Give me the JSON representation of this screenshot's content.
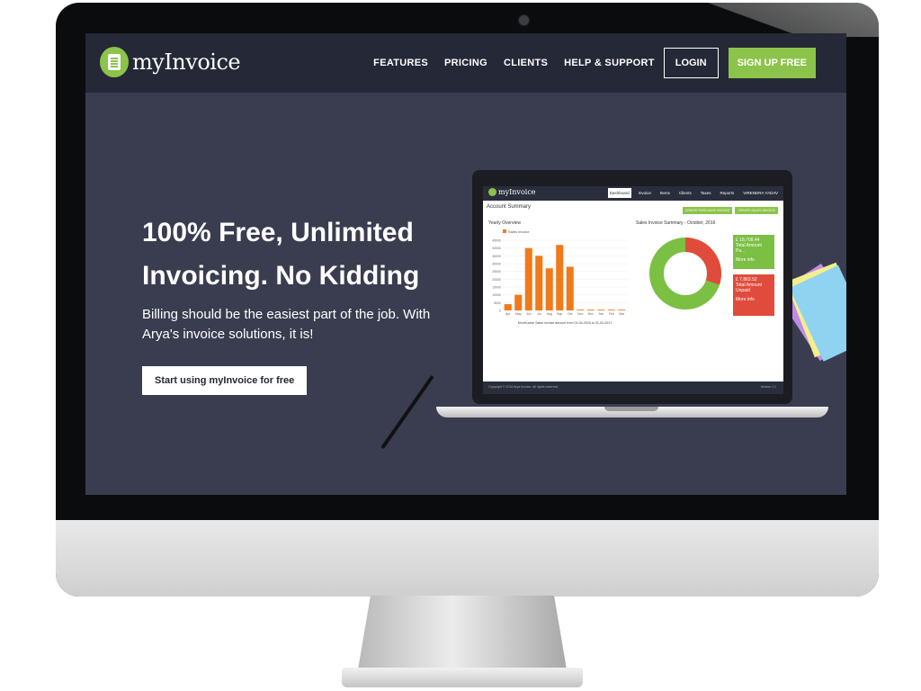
{
  "brand": {
    "name": "myInvoice",
    "accent": "#8cc34a"
  },
  "nav": {
    "links": [
      "FEATURES",
      "PRICING",
      "CLIENTS",
      "HELP & SUPPORT"
    ],
    "login": "LOGIN",
    "signup": "SIGN UP FREE"
  },
  "hero": {
    "title": "100% Free, Unlimited Invoicing. No Kidding",
    "subtitle": "Billing should be the easiest part of the job. With Arya's invoice solutions, it is!",
    "cta": "Start using myInvoice for free"
  },
  "preview": {
    "app_name": "myInvoice",
    "tabs": [
      "Dashboard",
      "Invoice",
      "Items",
      "Clients",
      "Taxes",
      "Reports"
    ],
    "active_tab": "Dashboard",
    "user": "VIRENDRA YADAV",
    "page_heading": "Account Summary",
    "actions": [
      "CREATE PURCHASE INVOICE",
      "CREATE SALES INVOICE"
    ],
    "yearly_heading": "Yearly Overview",
    "sales_summary_heading": "Sales Invoice Summary - October, 2016",
    "legend": "Sales invoice",
    "chart_caption": "Month-wise Sales invoice amount from 01-04-2016 to 31-03-2017",
    "stat_total": {
      "value": "£ 18,708.44",
      "label": "Total Amount Pa...",
      "link": "More info"
    },
    "stat_unpaid": {
      "value": "£ 7,863.52",
      "label": "Total Amount Unpaid",
      "link": "More info"
    },
    "footer": "Copyright © 2016 Arya Invoice. All rights reserved.",
    "version": "Version 1.1"
  },
  "chart_data": {
    "type": "bar",
    "categories": [
      "Apr",
      "May",
      "Jun",
      "Jul",
      "Aug",
      "Sep",
      "Oct",
      "Nov",
      "Dec",
      "Jan",
      "Feb",
      "Mar"
    ],
    "values": [
      4000,
      10000,
      40000,
      35000,
      27000,
      42000,
      28000,
      500,
      500,
      500,
      500,
      500
    ],
    "ylim": [
      0,
      45000
    ],
    "yticks": [
      "0",
      "5000",
      "10000",
      "15000",
      "20000",
      "25000",
      "30000",
      "35000",
      "40000",
      "45000"
    ],
    "donut": {
      "paid_fraction": 0.7,
      "unpaid_fraction": 0.3,
      "paid_color": "#7bbf43",
      "unpaid_color": "#e04b3c"
    },
    "bar_color": "#f07a1a"
  }
}
